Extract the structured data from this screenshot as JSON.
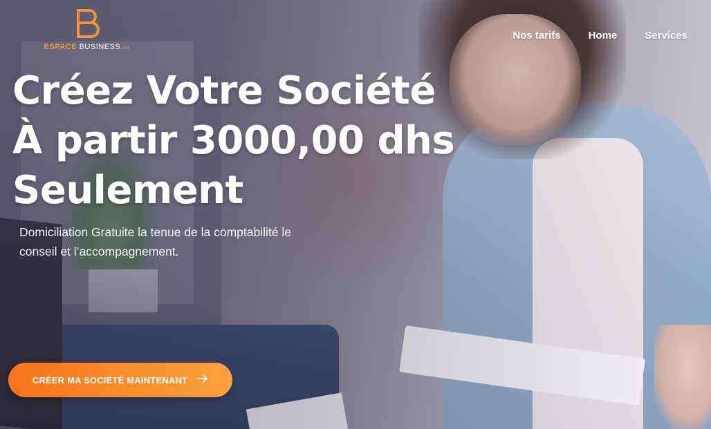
{
  "brand": {
    "name_accent": "ESPACE",
    "name_rest": " BUSINESS",
    "suffix": ".ma",
    "accent_color": "#f7923a"
  },
  "nav": {
    "items": [
      {
        "label": "Nos tarifs"
      },
      {
        "label": "Home"
      },
      {
        "label": "Services"
      }
    ]
  },
  "hero": {
    "headline_lines": [
      "Créez Votre Société",
      "À partir 3000,00 dhs",
      "Seulement"
    ],
    "subtext": "Domiciliation Gratuite la tenue de la comptabilité le conseil et l’accompagnement.",
    "cta_label": "CRÉER MA SOCIÉTÉ MAINTENANT",
    "cta_icon": "arrow-right-icon",
    "cta_color": "#f7831f"
  }
}
